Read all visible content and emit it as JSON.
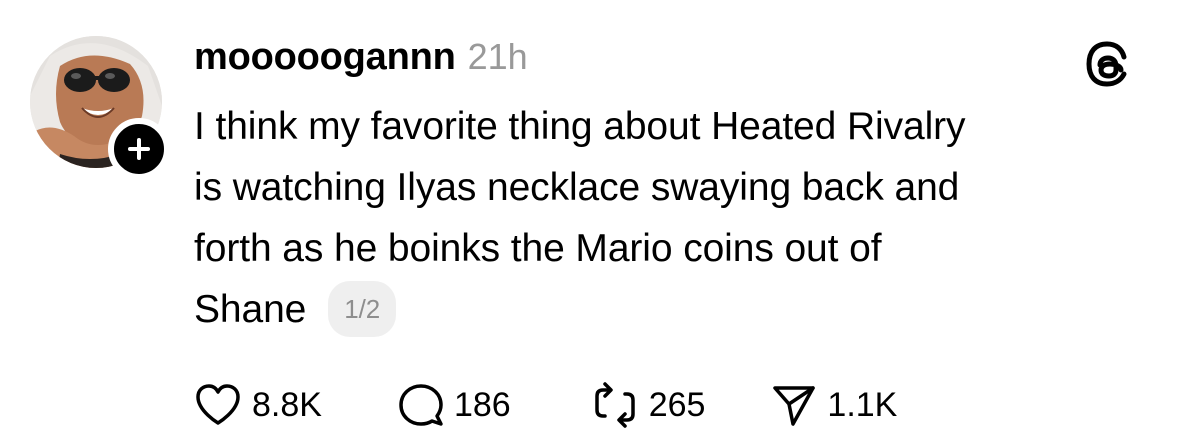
{
  "post": {
    "username": "mooooogannn",
    "timestamp": "21h",
    "text_lines": [
      "I think my favorite thing about Heated Rivalry",
      "is watching Ilyas necklace swaying back and",
      "forth as he boinks the Mario coins out of",
      "Shane"
    ],
    "page_indicator": "1/2"
  },
  "actions": {
    "likes": "8.8K",
    "replies": "186",
    "reposts": "265",
    "shares": "1.1K"
  },
  "icons": {
    "follow": "plus-icon",
    "brand": "threads-logo-icon",
    "like": "heart-icon",
    "reply": "speech-bubble-icon",
    "repost": "repost-arrows-icon",
    "share": "paper-plane-icon"
  },
  "colors": {
    "text": "#000000",
    "timestamp": "#999999",
    "badge_bg": "#efefef",
    "badge_text": "#8e8e8e"
  }
}
